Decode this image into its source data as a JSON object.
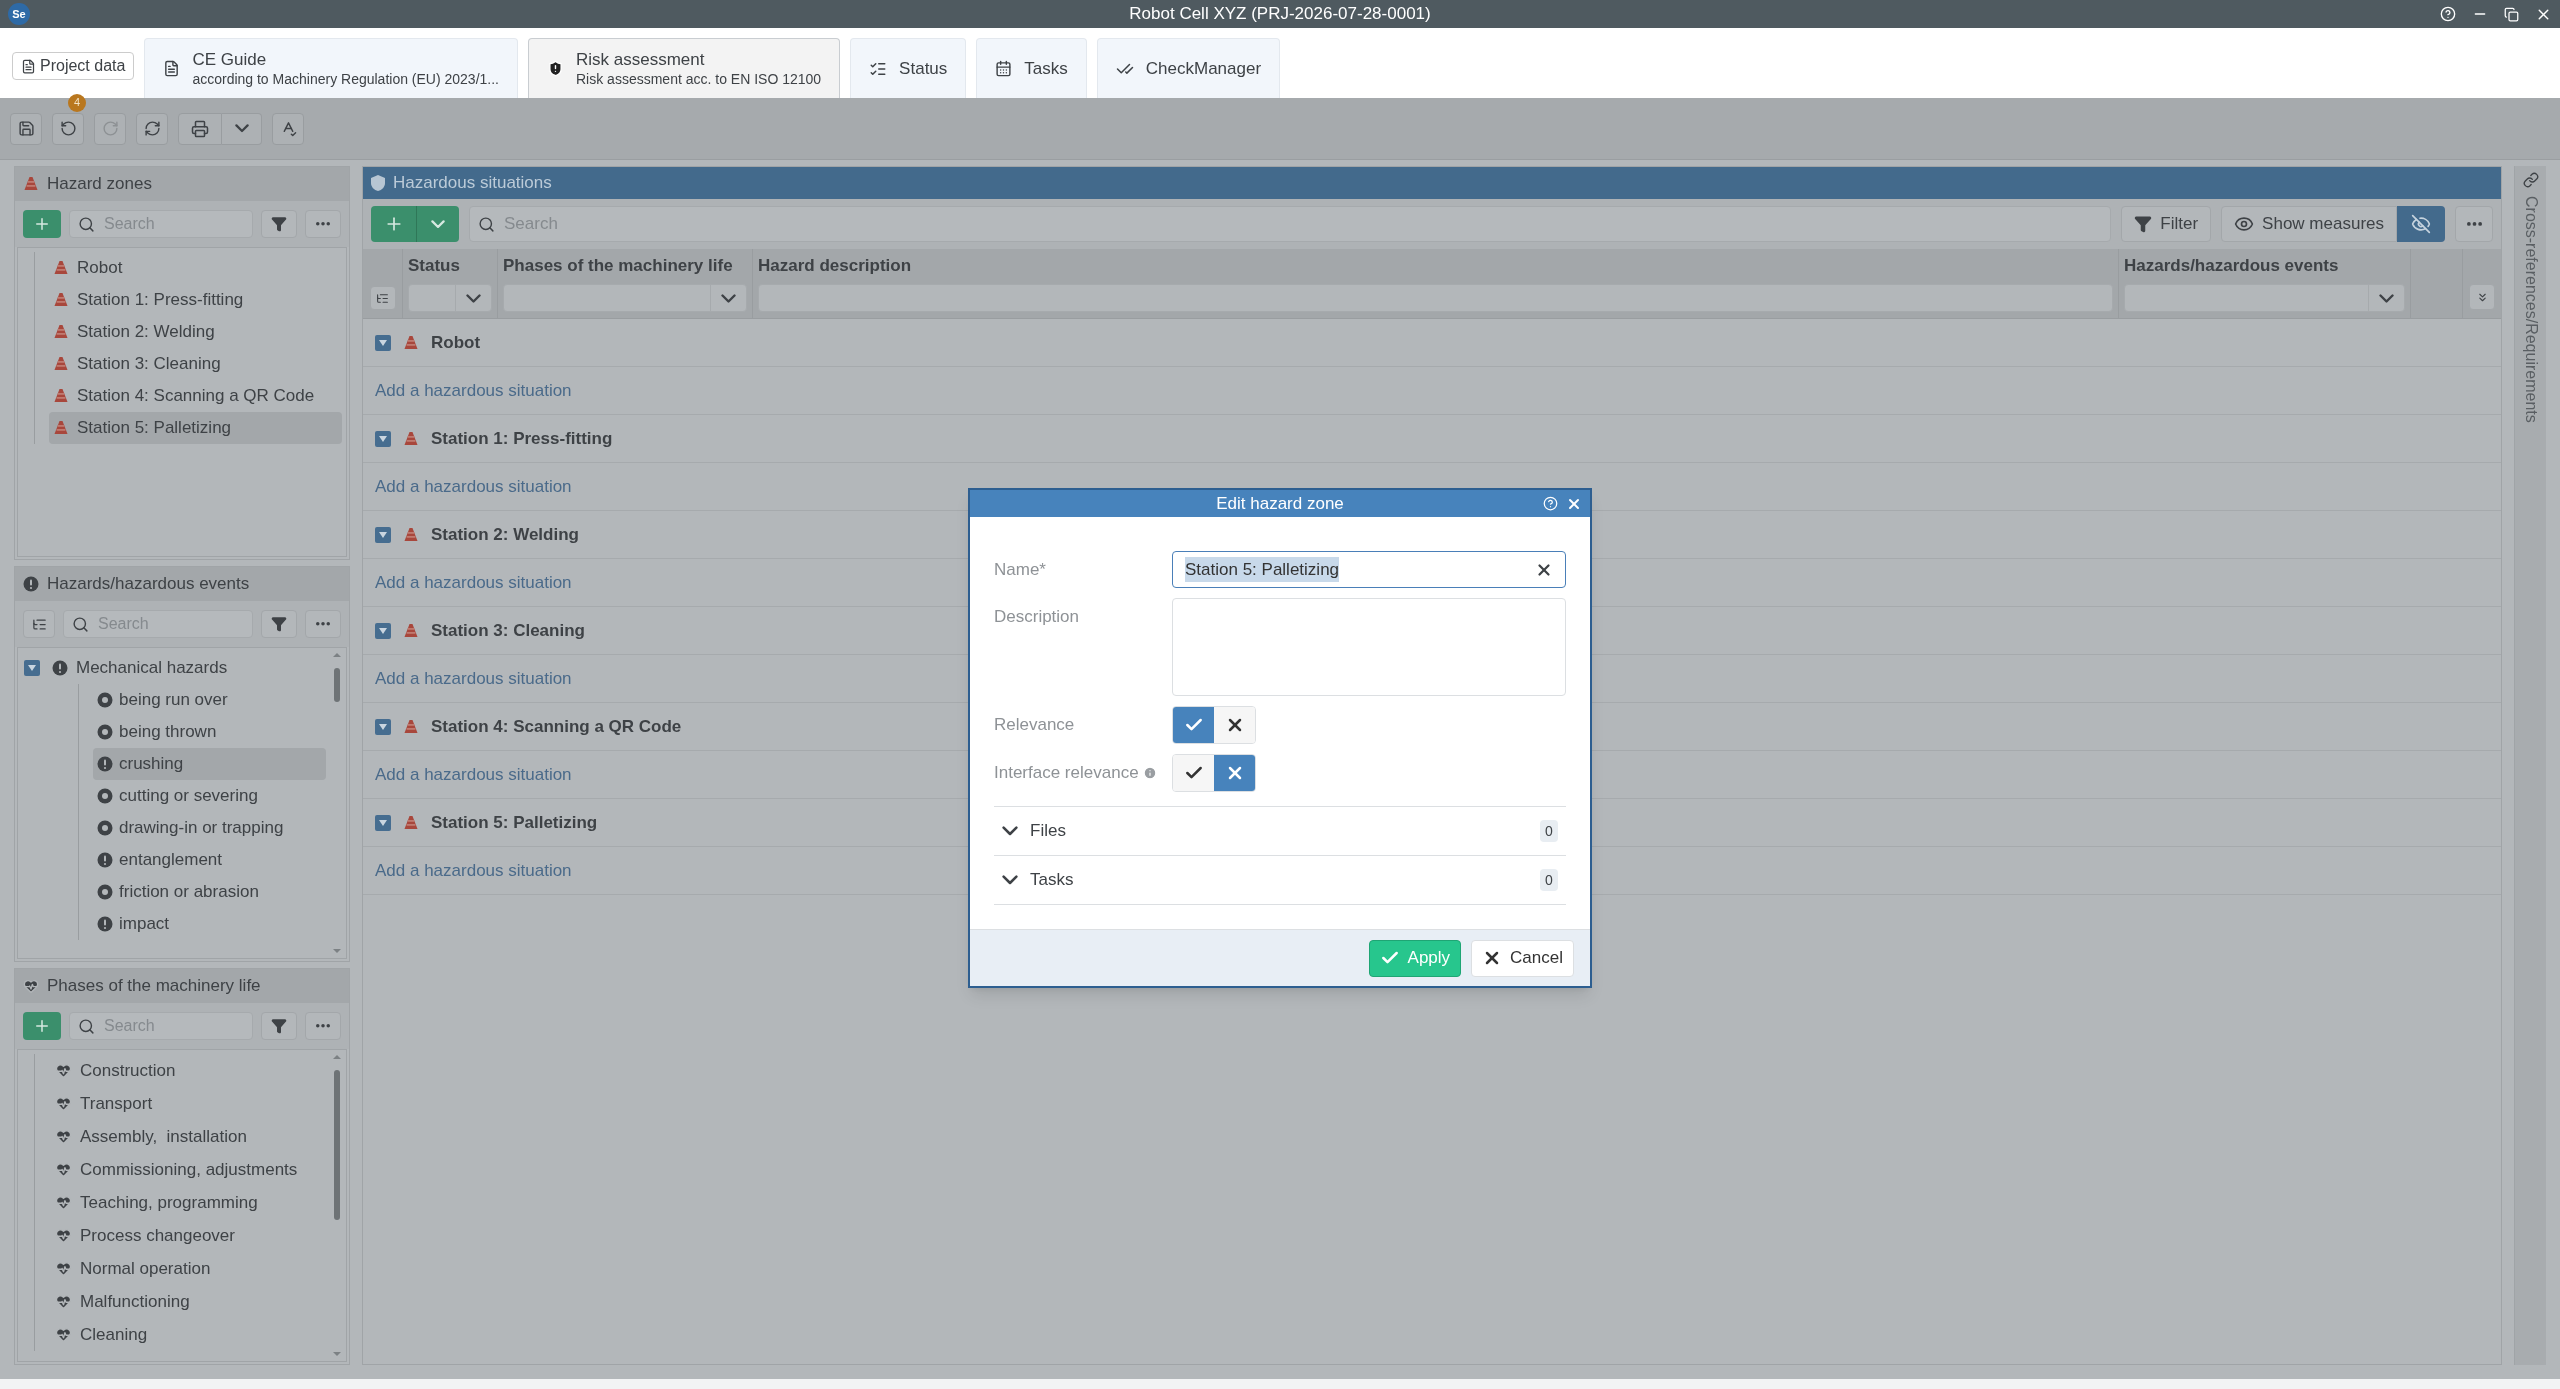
{
  "window": {
    "logo": "Se",
    "title": "Robot Cell XYZ (PRJ-2026-07-28-0001)"
  },
  "tabs": [
    {
      "kind": "small",
      "label": "Project data",
      "selected": false
    },
    {
      "kind": "document",
      "label": "CE Guide",
      "subtitle": "according to Machinery Regulation (EU) 2023/1...",
      "selected": false
    },
    {
      "kind": "shield",
      "label": "Risk assessment",
      "subtitle": "Risk assessment acc. to EN ISO 12100",
      "selected": true
    },
    {
      "kind": "list",
      "label": "Status",
      "selected": false
    },
    {
      "kind": "calendar",
      "label": "Tasks",
      "selected": false
    },
    {
      "kind": "check",
      "label": "CheckManager",
      "selected": false
    }
  ],
  "toolbar": {
    "undo_badge": "4"
  },
  "hazard_zones": {
    "title": "Hazard zones",
    "search_placeholder": "Search",
    "items": [
      {
        "label": "Robot",
        "selected": false
      },
      {
        "label": "Station 1: Press-fitting",
        "selected": false
      },
      {
        "label": "Station 2: Welding",
        "selected": false
      },
      {
        "label": "Station 3: Cleaning",
        "selected": false
      },
      {
        "label": "Station 4: Scanning a QR Code",
        "selected": false
      },
      {
        "label": "Station 5: Palletizing",
        "selected": true
      }
    ]
  },
  "hazards": {
    "title": "Hazards/hazardous events",
    "search_placeholder": "Search",
    "items": [
      {
        "label": "Mechanical hazards",
        "kind": "alert",
        "expanded": true,
        "selected": false,
        "children": [
          {
            "label": "being run over",
            "kind": "dot",
            "selected": false
          },
          {
            "label": "being thrown",
            "kind": "dot",
            "selected": false
          },
          {
            "label": "crushing",
            "kind": "alert",
            "selected": true
          },
          {
            "label": "cutting or severing",
            "kind": "dot",
            "selected": false
          },
          {
            "label": "drawing-in or trapping",
            "kind": "dot",
            "selected": false
          },
          {
            "label": "entanglement",
            "kind": "alert",
            "selected": false
          },
          {
            "label": "friction or abrasion",
            "kind": "dot",
            "selected": false
          },
          {
            "label": "impact",
            "kind": "alert",
            "selected": false
          }
        ]
      }
    ]
  },
  "phases": {
    "title": "Phases of the machinery life",
    "search_placeholder": "Search",
    "items": [
      {
        "label": "Construction"
      },
      {
        "label": "Transport"
      },
      {
        "label": "Assembly,  installation"
      },
      {
        "label": "Commissioning, adjustments"
      },
      {
        "label": "Teaching, programming"
      },
      {
        "label": "Process changeover"
      },
      {
        "label": "Normal operation"
      },
      {
        "label": "Malfunctioning"
      },
      {
        "label": "Cleaning"
      }
    ]
  },
  "situations": {
    "title": "Hazardous situations",
    "search_placeholder": "Search",
    "filter": "Filter",
    "show_measures": "Show measures",
    "hide_measures_on": true,
    "columns": [
      "Status",
      "Phases of the machinery life",
      "Hazard description",
      "Hazards/hazardous events"
    ],
    "groups": [
      {
        "zone": "Robot",
        "expanded": true,
        "add_label": "Add a hazardous situation"
      },
      {
        "zone": "Station 1: Press-fitting",
        "expanded": true,
        "add_label": "Add a hazardous situation"
      },
      {
        "zone": "Station 2: Welding",
        "expanded": true,
        "add_label": "Add a hazardous situation"
      },
      {
        "zone": "Station 3: Cleaning",
        "expanded": true,
        "add_label": "Add a hazardous situation"
      },
      {
        "zone": "Station 4: Scanning a QR Code",
        "expanded": true,
        "add_label": "Add a hazardous situation"
      },
      {
        "zone": "Station 5: Palletizing",
        "expanded": true,
        "add_label": "Add a hazardous situation"
      }
    ]
  },
  "side_rail": {
    "label": "Cross-references/Requirements"
  },
  "dialog": {
    "title": "Edit hazard zone",
    "fields": [
      {
        "kind": "text",
        "label": "Name*",
        "value": "Station 5: Palletizing"
      },
      {
        "kind": "textarea",
        "label": "Description"
      },
      {
        "kind": "toggle",
        "label": "Relevance",
        "on": true
      },
      {
        "kind": "toggle",
        "label": "Interface relevance",
        "on": false,
        "info": true
      }
    ],
    "sections": [
      {
        "label": "Files",
        "count": "0",
        "expanded": false
      },
      {
        "label": "Tasks",
        "count": "0",
        "expanded": false
      }
    ],
    "buttons": [
      {
        "kind": "primary",
        "label": "Apply"
      },
      {
        "kind": "secondary",
        "label": "Cancel"
      }
    ]
  }
}
